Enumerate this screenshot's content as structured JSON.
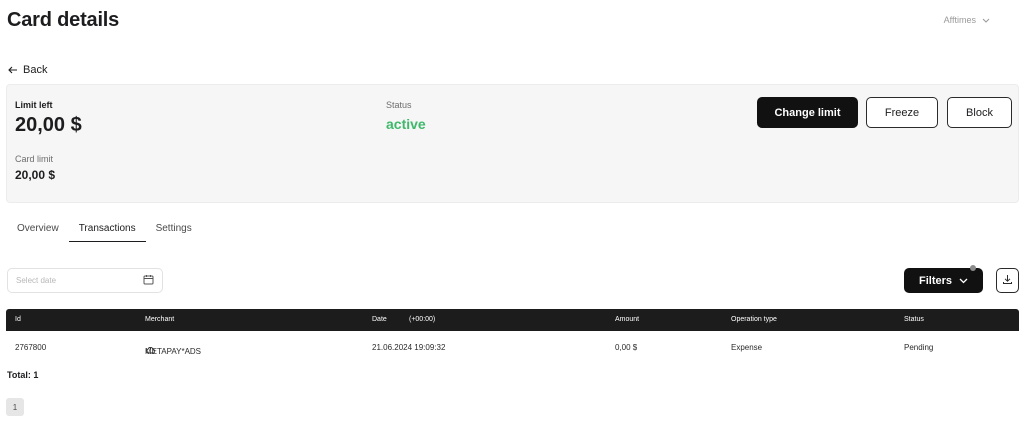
{
  "header": {
    "title": "Card details",
    "account_name": "Afftimes"
  },
  "back_label": "Back",
  "card": {
    "limit_left_label": "Limit left",
    "limit_left_value": "20,00 $",
    "card_limit_label": "Card limit",
    "card_limit_value": "20,00 $",
    "status_label": "Status",
    "status_value": "active",
    "status_color": "#3fb86b",
    "actions": {
      "change_limit": "Change limit",
      "freeze": "Freeze",
      "block": "Block"
    }
  },
  "tabs": [
    {
      "label": "Overview",
      "active": false
    },
    {
      "label": "Transactions",
      "active": true
    },
    {
      "label": "Settings",
      "active": false
    }
  ],
  "toolbar": {
    "date_placeholder": "Select date",
    "filters_label": "Filters",
    "download_icon": "download-icon",
    "calendar_icon": "calendar-icon"
  },
  "table": {
    "headers": {
      "id": "Id",
      "merchant": "Merchant",
      "date": "Date",
      "timezone": "(+00:00)",
      "amount": "Amount",
      "operation_type": "Operation type",
      "status": "Status"
    },
    "rows": [
      {
        "id": "2767800",
        "merchant": "METAPAY*ADS",
        "date": "21.06.2024 19:09:32",
        "amount": "0,00 $",
        "operation_type": "Expense",
        "status": "Pending"
      }
    ]
  },
  "total_label": "Total: 1",
  "pagination": {
    "current_page": "1"
  }
}
